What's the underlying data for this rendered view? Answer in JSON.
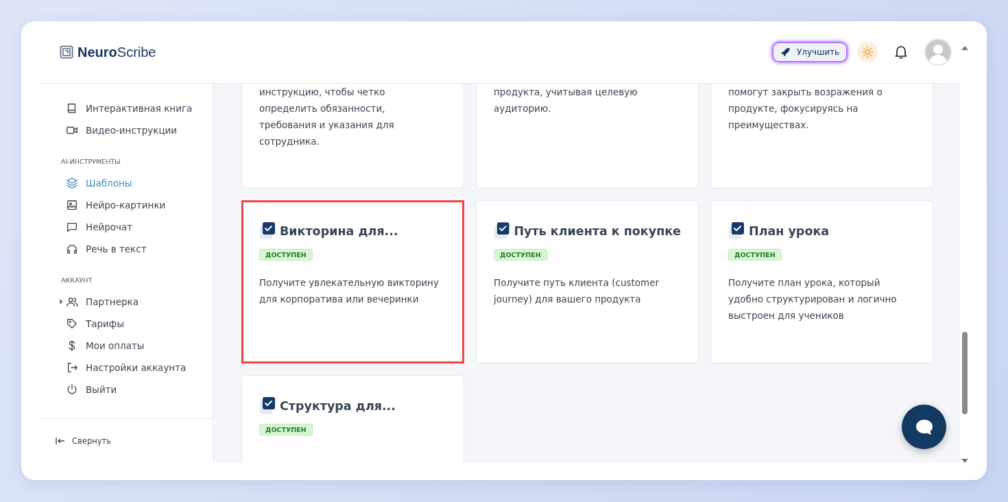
{
  "logo": {
    "bold": "Neuro",
    "light": "Scribe"
  },
  "header": {
    "upgrade_button": "Улучшить"
  },
  "sidebar": {
    "groups": [
      {
        "items": [
          {
            "label": "Интерактивная книга",
            "selected": false,
            "expandable": false
          },
          {
            "label": "Видео-инструкции",
            "selected": false,
            "expandable": false
          }
        ]
      },
      {
        "label": "AI-ИНСТРУМЕНТЫ",
        "items": [
          {
            "label": "Шаблоны",
            "selected": true,
            "expandable": false
          },
          {
            "label": "Нейро-картинки",
            "selected": false,
            "expandable": false
          },
          {
            "label": "Нейрочат",
            "selected": false,
            "expandable": false
          },
          {
            "label": "Речь в текст",
            "selected": false,
            "expandable": false
          }
        ]
      },
      {
        "label": "АККАУНТ",
        "items": [
          {
            "label": "Партнерка",
            "selected": false,
            "expandable": true
          },
          {
            "label": "Тарифы",
            "selected": false,
            "expandable": false
          },
          {
            "label": "Мои оплаты",
            "selected": false,
            "expandable": false
          },
          {
            "label": "Настройки аккаунта",
            "selected": false,
            "expandable": false
          },
          {
            "label": "Выйти",
            "selected": false,
            "expandable": false
          }
        ]
      }
    ],
    "collapse": "Свернуть"
  },
  "top_cards": [
    {
      "lines": [
        "инструкцию, чтобы четко",
        "определить обязанности,",
        "требования и указания для",
        "сотрудника."
      ]
    },
    {
      "lines": [
        "продукта, учитывая целевую",
        "аудиторию."
      ]
    },
    {
      "lines": [
        "помогут закрыть возражения о",
        "продукте, фокусируясь на",
        "преимуществах."
      ]
    }
  ],
  "cards": [
    {
      "title": "Викторина для...",
      "badge": "ДОСТУПЕН",
      "description": "Получите увлекательную викторину для корпоратива или вечеринки",
      "selected": true
    },
    {
      "title": "Путь клиента к покупке",
      "badge": "ДОСТУПЕН",
      "description": "Получите путь клиента (customer journey) для вашего продукта",
      "selected": false
    },
    {
      "title": "План урока",
      "badge": "ДОСТУПЕН",
      "description": "Получите план урока, который удобно структурирован и логично выстроен для учеников",
      "selected": false
    },
    {
      "title": "Структура для...",
      "badge": "ДОСТУПЕН",
      "selected": false
    }
  ]
}
